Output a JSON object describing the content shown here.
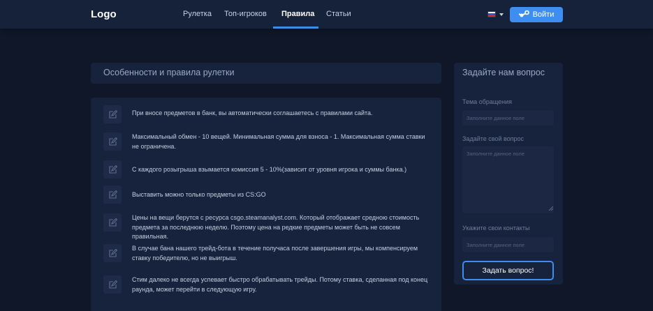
{
  "header": {
    "logo": "Logo",
    "nav": [
      {
        "label": "Рулетка",
        "active": false
      },
      {
        "label": "Топ-игроков",
        "active": false
      },
      {
        "label": "Правила",
        "active": true
      },
      {
        "label": "Статьи",
        "active": false
      }
    ],
    "language": "RU",
    "login_label": "Войти",
    "accent_color": "#3d8ef0"
  },
  "rules": {
    "title": "Особенности и правила рулетки",
    "items": [
      {
        "icon": "edit-icon",
        "text": "При вносе предметов в банк, вы автоматически соглашаетесь с правилами сайта."
      },
      {
        "icon": "edit-icon",
        "text": "Максимальный обмен - 10 вещей. Минимальная сумма для взноса - 1. Максимальная сумма ставки не ограничена."
      },
      {
        "icon": "edit-icon",
        "text": "С каждого розыгрыша взымается комиссия 5 - 10%(зависит от уровня игрока и суммы банка.)"
      },
      {
        "icon": "edit-icon",
        "text": "Выставить можно только предметы из CS:GO"
      },
      {
        "icon": "edit-icon",
        "text": "Цены на вещи берутся с ресурса csgo.steamanalyst.com. Который отображает средною стоимость предмета за последнюю неделю. Поэтому цена на редкие предметы может быть не совсем правильная."
      },
      {
        "icon": "edit-icon",
        "text": "В случае бана нашего трейд-бота в течение получаса после завершения игры, мы компенсируем ставку победителю, но не выигрыш."
      },
      {
        "icon": "edit-icon",
        "text": "Стим далеко не всегда успевает быстро обрабатывать трейды. Потому ставка, сделанная под конец раунда, может перейти в следующую игру."
      }
    ]
  },
  "ask": {
    "title": "Задайте нам вопрос",
    "subject_label": "Тема обращения",
    "subject_placeholder": "Заполните данное поле",
    "question_label": "Задайте свой вопрос",
    "question_placeholder": "Заполните данное поле",
    "contacts_label": "Укажите свои контакты",
    "contacts_placeholder": "Заполните данное поле",
    "submit_label": "Задать вопрос!"
  }
}
